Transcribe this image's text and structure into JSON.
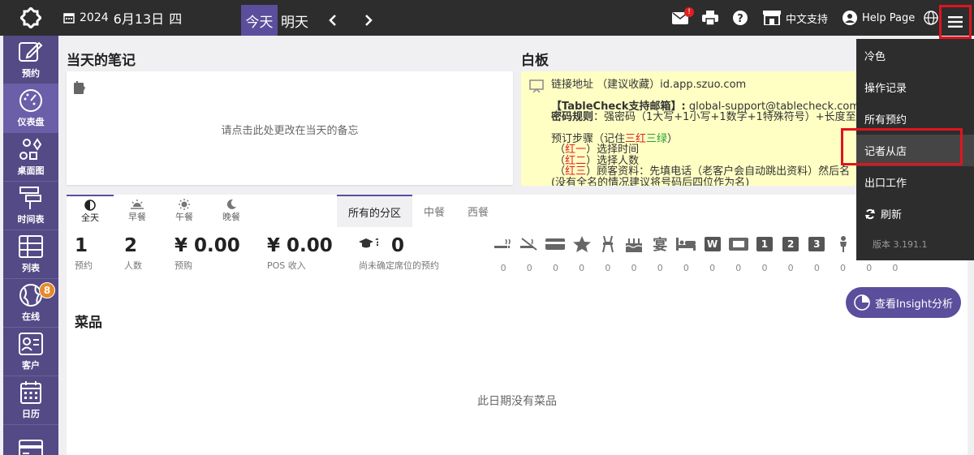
{
  "topbar": {
    "year": "2024",
    "date": "6月13日",
    "weekday": "四",
    "today_label": "今天",
    "tomorrow_label": "明天",
    "mail_badge": "!",
    "support_label": "中文支持",
    "help_label": "Help Page"
  },
  "sidebar": {
    "items": [
      {
        "label": "预约",
        "icon": "edit-icon"
      },
      {
        "label": "仪表盘",
        "icon": "dashboard-gauge-icon"
      },
      {
        "label": "桌面图",
        "icon": "floor-shapes-icon"
      },
      {
        "label": "时间表",
        "icon": "timeline-icon"
      },
      {
        "label": "列表",
        "icon": "table-list-icon"
      },
      {
        "label": "在线",
        "icon": "globe-icon",
        "badge": "8"
      },
      {
        "label": "客户",
        "icon": "contact-card-icon"
      },
      {
        "label": "日历",
        "icon": "calendar-icon"
      },
      {
        "label": "",
        "icon": "credit-card-icon"
      }
    ]
  },
  "notes": {
    "title": "当天的笔记",
    "placeholder": "请点击此处更改在当天的备忘"
  },
  "board": {
    "title": "白板",
    "line1": "链接地址 （建议收藏）id.app.szuo.com",
    "line2a": "【TableCheck支持邮箱】:",
    "line2b": " global-support@tablecheck.com",
    "line3a": "密码规则",
    "line3b": "：强密码（1大写+1小写+1数字+1特殊符号）+长度至",
    "line4a": "预订步骤（记住",
    "line4b": "三红",
    "line4c": "三绿",
    "line4d": "）",
    "line5a": "（",
    "line5b": "红一",
    "line5c": "）选择时间",
    "line6b": "红二",
    "line6c": "）选择人数",
    "line7b": "红三",
    "line7c": "）顾客资料：先填电话（老客户会自动跳出资料）然后名",
    "line8": "(没有全名的情况建议将号码后四位作为名)"
  },
  "meal_tabs": [
    {
      "label": "全天",
      "icon": "half-circle-icon"
    },
    {
      "label": "早餐",
      "icon": "sunrise-icon"
    },
    {
      "label": "午餐",
      "icon": "sun-icon"
    },
    {
      "label": "晚餐",
      "icon": "moon-icon"
    }
  ],
  "area_tabs": [
    "所有的分区",
    "中餐",
    "西餐"
  ],
  "stats": [
    {
      "value": "1",
      "label": "预约"
    },
    {
      "value": "2",
      "label": "人数"
    },
    {
      "value": "¥ 0.00",
      "label": "预购"
    },
    {
      "value": "¥ 0.00",
      "label": "POS 收入"
    },
    {
      "value": "0",
      "label": "尚未确定席位的预约"
    }
  ],
  "status_counts": [
    "0",
    "0",
    "0",
    "0",
    "0",
    "0",
    "0",
    "0",
    "0",
    "0",
    "0",
    "0",
    "0",
    "0",
    "0",
    "0"
  ],
  "status_box_labels": [
    "W",
    "1",
    "2",
    "3"
  ],
  "insight_label": "查看Insight分析",
  "dishes": {
    "title": "菜品",
    "empty": "此日期没有菜品"
  },
  "dropdown": {
    "items": [
      "冷色",
      "操作记录",
      "所有预约",
      "记者从店",
      "出口工作",
      "刷新"
    ],
    "version": "版本 3.191.1"
  },
  "colors": {
    "topbar": "#2d2d2d",
    "sidebar": "#544a86",
    "accent": "#5b4e9c",
    "board_bg": "#ffffc4",
    "badge_orange": "#e8892a",
    "highlight_red": "#e0141e"
  }
}
